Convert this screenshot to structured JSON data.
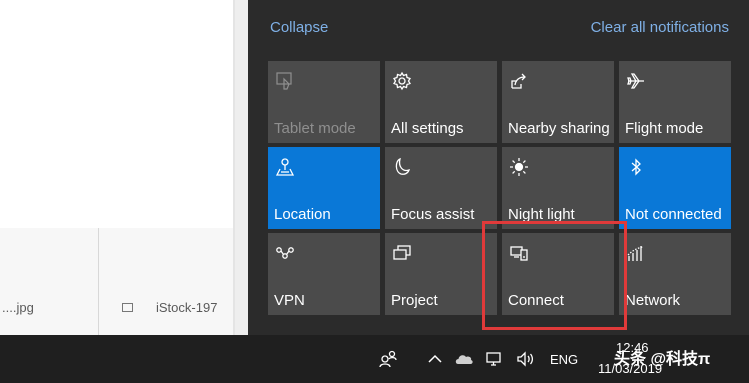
{
  "action_center": {
    "collapse_label": "Collapse",
    "clear_all_label": "Clear all notifications",
    "tiles": [
      {
        "label": "Tablet mode",
        "icon": "tablet-mode-icon",
        "active": false,
        "disabled": true
      },
      {
        "label": "All settings",
        "icon": "gear-icon",
        "active": false,
        "disabled": false
      },
      {
        "label": "Nearby sharing",
        "icon": "share-icon",
        "active": false,
        "disabled": false
      },
      {
        "label": "Flight mode",
        "icon": "airplane-icon",
        "active": false,
        "disabled": false
      },
      {
        "label": "Location",
        "icon": "location-icon",
        "active": true,
        "disabled": false
      },
      {
        "label": "Focus assist",
        "icon": "moon-icon",
        "active": false,
        "disabled": false
      },
      {
        "label": "Night light",
        "icon": "sun-icon",
        "active": false,
        "disabled": false
      },
      {
        "label": "Not connected",
        "icon": "bluetooth-icon",
        "active": true,
        "disabled": false
      },
      {
        "label": "VPN",
        "icon": "vpn-icon",
        "active": false,
        "disabled": false
      },
      {
        "label": "Project",
        "icon": "project-icon",
        "active": false,
        "disabled": false
      },
      {
        "label": "Connect",
        "icon": "connect-icon",
        "active": false,
        "disabled": false
      },
      {
        "label": "Network",
        "icon": "network-icon",
        "active": false,
        "disabled": false
      }
    ],
    "accent_color": "#0a78d7",
    "highlight_color": "#e03a3a"
  },
  "explorer": {
    "file1_name": "....jpg",
    "file2_name": "iStock-197"
  },
  "taskbar": {
    "language": "ENG",
    "time": "12:46",
    "date": "11/03/2019",
    "watermark": "头条 @科技π"
  }
}
